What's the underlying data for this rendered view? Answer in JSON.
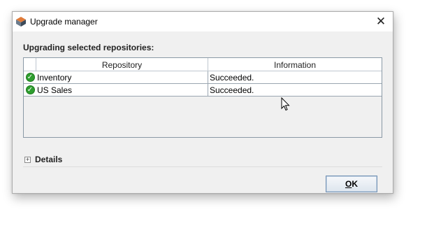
{
  "window": {
    "title": "Upgrade manager",
    "close_glyph": "✕"
  },
  "heading": "Upgrading selected repositories:",
  "table": {
    "columns": [
      "",
      "Repository",
      "Information"
    ],
    "rows": [
      {
        "status_icon": "success-check-icon",
        "repository": "Inventory",
        "information": "Succeeded."
      },
      {
        "status_icon": "success-check-icon",
        "repository": "US Sales",
        "information": "Succeeded."
      }
    ]
  },
  "details": {
    "expand_glyph": "+",
    "label": "Details"
  },
  "ok_button": {
    "mnemonic": "O",
    "rest": "K"
  },
  "colors": {
    "success": "#2f9e2f",
    "button_border": "#6f8fb3"
  }
}
